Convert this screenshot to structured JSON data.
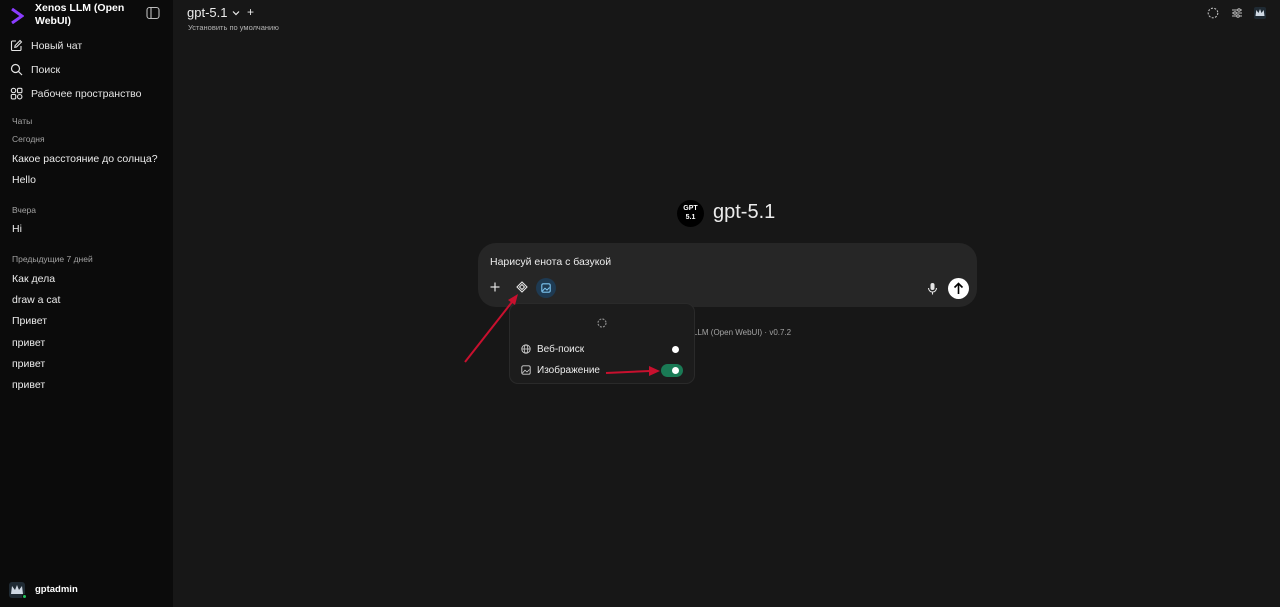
{
  "app": {
    "title": "Xenos LLM (Open WebUI)",
    "version_text": "LLM (Open WebUI) · v0.7.2"
  },
  "sidebar": {
    "nav": [
      {
        "label": "Новый чат",
        "icon": "pencil-square-icon"
      },
      {
        "label": "Поиск",
        "icon": "search-icon"
      },
      {
        "label": "Рабочее пространство",
        "icon": "workspace-grid-icon"
      }
    ],
    "chats_label": "Чаты",
    "groups": [
      {
        "label": "Сегодня",
        "items": [
          "Какое расстояние до солнца?",
          "Hello"
        ]
      },
      {
        "label": "Вчера",
        "items": [
          "Hi"
        ]
      },
      {
        "label": "Предыдущие 7 дней",
        "items": [
          "Как дела",
          "draw a cat",
          "Привет",
          "привет",
          "привет",
          "привет"
        ]
      }
    ],
    "user": {
      "name": "gptadmin",
      "status": "online"
    }
  },
  "header": {
    "model_name": "gpt-5.1",
    "set_default": "Установить по умолчанию",
    "icons": [
      "dashed-circle-icon",
      "sliders-icon",
      "user-avatar-icon"
    ]
  },
  "main": {
    "badge_line1": "GPT",
    "badge_line2": "5.1",
    "model_title": "gpt-5.1",
    "prompt": "Нарисуй енота с базукой"
  },
  "tools_menu": {
    "items": [
      {
        "label": "Веб-поиск",
        "icon": "globe-icon",
        "enabled": false
      },
      {
        "label": "Изображение",
        "icon": "image-icon",
        "enabled": true
      }
    ]
  },
  "colors": {
    "background": "#171717",
    "sidebar": "#0b0b0b",
    "composer": "#262626",
    "toggle_on": "#1a7a55",
    "annotation_arrow": "#c8102e",
    "brand_logo": "#8b3dff"
  }
}
